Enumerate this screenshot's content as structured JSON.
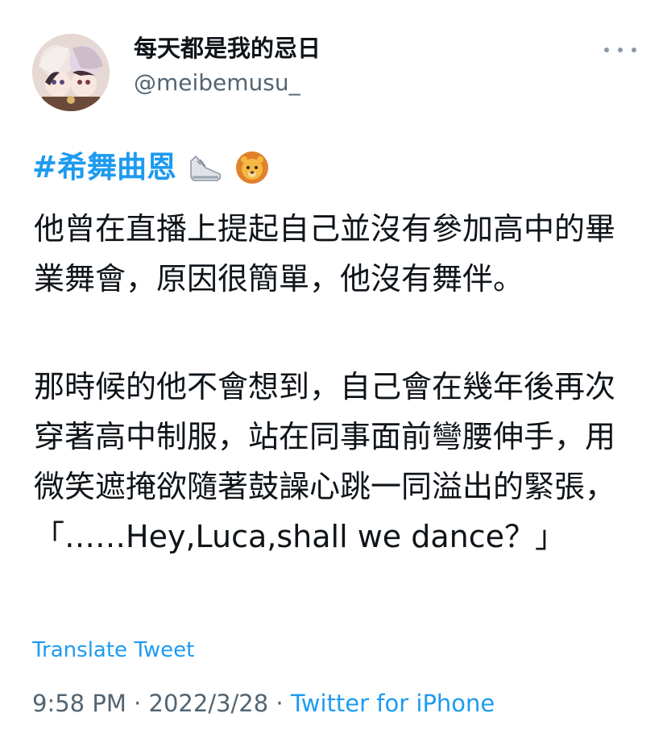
{
  "tweet": {
    "author": {
      "display_name": "每天都是我的忌日",
      "handle": "@meibemusu_",
      "avatar_icon": "avatar-illustration"
    },
    "more_icon": "more-dots-icon",
    "hashtag": "#希舞曲恩",
    "emojis": [
      "sneaker-emoji",
      "lion-face-emoji"
    ],
    "paragraphs": [
      "他曾在直播上提起自己並沒有參加高中的畢業舞會，原因很簡單，他沒有舞伴。",
      "那時候的他不會想到，自己會在幾年後再次穿著高中制服，站在同事面前彎腰伸手，用微笑遮掩欲隨著鼓譟心跳一同溢出的緊張，「……Hey,Luca,shall we dance？」"
    ],
    "translate_label": "Translate Tweet",
    "time": "9:58 PM",
    "separator": " · ",
    "date": "2022/3/28",
    "source": "Twitter for iPhone"
  },
  "colors": {
    "accent": "#1d9bf0",
    "text": "#0f1419",
    "secondary": "#536471"
  }
}
